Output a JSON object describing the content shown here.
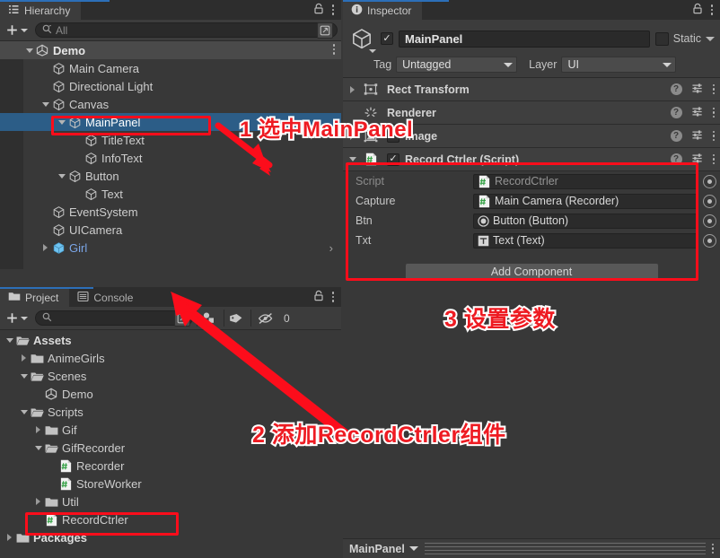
{
  "hierarchy": {
    "tab_label": "Hierarchy",
    "lock_icon": "lock-icon",
    "menu_icon": "kebab-menu-icon",
    "add_label": "+",
    "search_placeholder": "All",
    "search_icon": "search-icon",
    "items": [
      {
        "label": "Demo",
        "indent": 0,
        "toggle": "down",
        "icon": "unity-scene-icon",
        "state": "scene"
      },
      {
        "label": "Main Camera",
        "indent": 1,
        "toggle": "none",
        "icon": "gameobject-icon",
        "state": "normal"
      },
      {
        "label": "Directional Light",
        "indent": 1,
        "toggle": "none",
        "icon": "gameobject-icon",
        "state": "normal"
      },
      {
        "label": "Canvas",
        "indent": 1,
        "toggle": "down",
        "icon": "gameobject-icon",
        "state": "normal"
      },
      {
        "label": "MainPanel",
        "indent": 2,
        "toggle": "down",
        "icon": "gameobject-icon",
        "state": "selected"
      },
      {
        "label": "TitleText",
        "indent": 3,
        "toggle": "none",
        "icon": "gameobject-icon",
        "state": "normal"
      },
      {
        "label": "InfoText",
        "indent": 3,
        "toggle": "none",
        "icon": "gameobject-icon",
        "state": "normal"
      },
      {
        "label": "Button",
        "indent": 2,
        "toggle": "down",
        "icon": "gameobject-icon",
        "state": "normal"
      },
      {
        "label": "Text",
        "indent": 3,
        "toggle": "none",
        "icon": "gameobject-icon",
        "state": "normal"
      },
      {
        "label": "EventSystem",
        "indent": 1,
        "toggle": "none",
        "icon": "gameobject-icon",
        "state": "normal"
      },
      {
        "label": "UICamera",
        "indent": 1,
        "toggle": "none",
        "icon": "gameobject-icon",
        "state": "normal"
      },
      {
        "label": "Girl",
        "indent": 1,
        "toggle": "right",
        "icon": "prefab-icon",
        "state": "prefab"
      }
    ]
  },
  "project": {
    "tab_label": "Project",
    "console_tab_label": "Console",
    "lock_icon": "lock-icon",
    "menu_icon": "kebab-menu-icon",
    "add_label": "+",
    "search_placeholder": "",
    "search_icon": "search-icon",
    "filter_type_icon": "filter-by-type-icon",
    "filter_label_icon": "filter-by-label-icon",
    "filter_hidden_icon": "hidden-filter-icon",
    "hidden_count": "0",
    "items": [
      {
        "label": "Assets",
        "indent": 0,
        "toggle": "down",
        "icon": "folder-open-icon",
        "bold": true
      },
      {
        "label": "AnimeGirls",
        "indent": 1,
        "toggle": "right",
        "icon": "folder-icon",
        "bold": false
      },
      {
        "label": "Scenes",
        "indent": 1,
        "toggle": "down",
        "icon": "folder-open-icon",
        "bold": false
      },
      {
        "label": "Demo",
        "indent": 2,
        "toggle": "none",
        "icon": "unity-scene-icon",
        "bold": false
      },
      {
        "label": "Scripts",
        "indent": 1,
        "toggle": "down",
        "icon": "folder-open-icon",
        "bold": false
      },
      {
        "label": "Gif",
        "indent": 2,
        "toggle": "right",
        "icon": "folder-icon",
        "bold": false
      },
      {
        "label": "GifRecorder",
        "indent": 2,
        "toggle": "down",
        "icon": "folder-open-icon",
        "bold": false
      },
      {
        "label": "Recorder",
        "indent": 3,
        "toggle": "none",
        "icon": "csharp-script-icon",
        "bold": false
      },
      {
        "label": "StoreWorker",
        "indent": 3,
        "toggle": "none",
        "icon": "csharp-script-icon",
        "bold": false
      },
      {
        "label": "Util",
        "indent": 2,
        "toggle": "right",
        "icon": "folder-icon",
        "bold": false
      },
      {
        "label": "RecordCtrler",
        "indent": 2,
        "toggle": "none",
        "icon": "csharp-script-icon",
        "bold": false
      },
      {
        "label": "Packages",
        "indent": 0,
        "toggle": "right",
        "icon": "folder-icon",
        "bold": true
      }
    ]
  },
  "inspector": {
    "tab_label": "Inspector",
    "info_icon": "info-icon",
    "lock_icon": "lock-icon",
    "menu_icon": "kebab-menu-icon",
    "gameobject_icon": "gameobject-icon",
    "enabled_checkbox": "✓",
    "object_name": "MainPanel",
    "static_label": "Static",
    "tag_label": "Tag",
    "tag_value": "Untagged",
    "layer_label": "Layer",
    "layer_value": "UI",
    "components": [
      {
        "title": "Rect Transform",
        "toggle": "right",
        "icon": "rect-transform-icon",
        "has_enable": false
      },
      {
        "title": "Renderer",
        "toggle": "none",
        "icon": "renderer-icon",
        "has_enable": false
      },
      {
        "title": "Image",
        "toggle": "right",
        "icon": "image-component-icon",
        "has_enable": true
      }
    ],
    "script_component": {
      "title": "Record Ctrler (Script)",
      "icon": "csharp-script-icon",
      "toggle": "down",
      "enabled_checkbox": "✓",
      "help_icon": "help-icon",
      "preset_icon": "preset-icon",
      "menu_icon": "kebab-menu-icon",
      "properties": [
        {
          "name": "Script",
          "value": "RecordCtrler",
          "icon": "csharp-script-icon",
          "dim": true,
          "picker": "object-picker-icon"
        },
        {
          "name": "Capture",
          "value": "Main Camera (Recorder)",
          "icon": "csharp-script-icon",
          "dim": false,
          "picker": "object-picker-icon"
        },
        {
          "name": "Btn",
          "value": "Button (Button)",
          "icon": "button-component-icon",
          "dim": false,
          "picker": "object-picker-icon"
        },
        {
          "name": "Txt",
          "value": "Text (Text)",
          "icon": "text-component-icon",
          "dim": false,
          "picker": "object-picker-icon"
        }
      ]
    },
    "add_component_label": "Add Component",
    "status_name": "MainPanel",
    "status_menu_icon": "kebab-menu-icon"
  },
  "annotations": [
    {
      "id": "step1",
      "text": "1 选中MainPanel"
    },
    {
      "id": "step2",
      "text": "2 添加RecordCtrler组件"
    },
    {
      "id": "step3",
      "text": "3 设置参数"
    }
  ],
  "colors": {
    "annotation_red": "#ee1b22",
    "highlight_box": "#fc0d1b",
    "selection_blue": "#2c5d87",
    "prefab_blue": "#7ba6e8"
  }
}
